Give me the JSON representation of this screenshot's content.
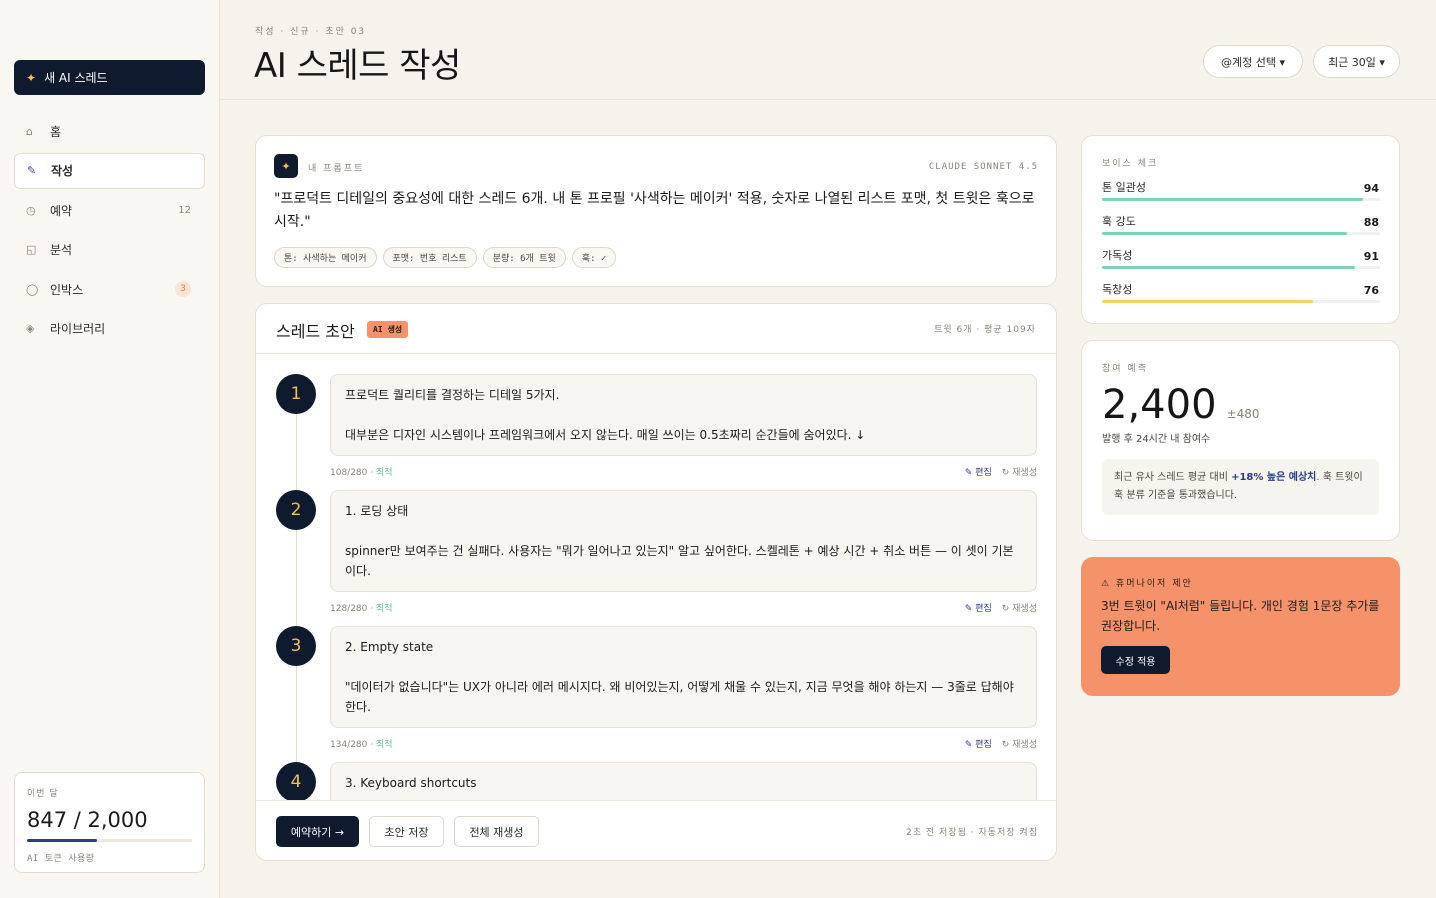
{
  "sidebar": {
    "new_button": "새 AI 스레드",
    "items": [
      {
        "icon": "home-icon",
        "glyph": "⌂",
        "label": "홈"
      },
      {
        "icon": "pencil-icon",
        "glyph": "✎",
        "label": "작성"
      },
      {
        "icon": "clock-icon",
        "glyph": "◷",
        "label": "예약",
        "count": "12"
      },
      {
        "icon": "chart-icon",
        "glyph": "◱",
        "label": "분석"
      },
      {
        "icon": "inbox-icon",
        "glyph": "◯",
        "label": "인박스",
        "badge": "3"
      },
      {
        "icon": "library-icon",
        "glyph": "◈",
        "label": "라이브러리"
      }
    ],
    "usage": {
      "label": "이번 달",
      "value": "847 / 2,000",
      "fraction": 0.4235,
      "sub": "AI 토큰 사용량"
    }
  },
  "header": {
    "breadcrumb": "작성 · 신규 · 초안 03",
    "title": "AI 스레드 작성",
    "account_button": "@계정 선택 ▾",
    "range_button": "최근 30일 ▾"
  },
  "prompt": {
    "label": "내 프롬프트",
    "model": "CLAUDE SONNET 4.5",
    "text": "\"프로덕트 디테일의 중요성에 대한 스레드 6개. 내 톤 프로필 '사색하는 메이커' 적용, 숫자로 나열된 리스트 포맷, 첫 트윗은 훅으로 시작.\"",
    "tags": [
      "톤: 사색하는 메이커",
      "포맷: 번호 리스트",
      "분량: 6개 트윗",
      "훅: ✓"
    ]
  },
  "thread": {
    "title": "스레드 초안",
    "badge": "AI 생성",
    "meta": "트윗 6개 · 평균 109자",
    "tweets": [
      {
        "num": "1",
        "paras": [
          "프로덕트 퀄리티를 결정하는 디테일 5가지.",
          "대부분은 디자인 시스템이나 프레임워크에서 오지 않는다. 매일 쓰이는 0.5초짜리 순간들에 숨어있다. ↓"
        ],
        "count": "108/280",
        "status": "최적"
      },
      {
        "num": "2",
        "paras": [
          "1. 로딩 상태",
          "spinner만 보여주는 건 실패다. 사용자는 \"뭐가 일어나고 있는지\" 알고 싶어한다. 스켈레톤 + 예상 시간 + 취소 버튼 — 이 셋이 기본이다."
        ],
        "count": "128/280",
        "status": "최적"
      },
      {
        "num": "3",
        "paras": [
          "2. Empty state",
          "\"데이터가 없습니다\"는 UX가 아니라 에러 메시지다. 왜 비어있는지, 어떻게 채울 수 있는지, 지금 무엇을 해야 하는지 — 3줄로 답해야 한다."
        ],
        "count": "134/280",
        "status": "최적"
      },
      {
        "num": "4",
        "paras": [
          "3. Keyboard shortcuts"
        ],
        "count": "",
        "status": ""
      }
    ],
    "edit_label": "✎ 편집",
    "regen_label": "↻ 재생성",
    "footer": {
      "schedule": "예약하기 →",
      "save_draft": "초안 저장",
      "regen_all": "전체 재생성",
      "status": "2초 전 저장됨 · 자동저장 켜짐"
    }
  },
  "voice": {
    "label": "보이스 체크",
    "metrics": [
      {
        "name": "톤 일관성",
        "score": 94,
        "color": "#7fd1b9"
      },
      {
        "name": "훅 강도",
        "score": 88,
        "color": "#7fd1b9"
      },
      {
        "name": "가독성",
        "score": 91,
        "color": "#7fd1b9"
      },
      {
        "name": "독창성",
        "score": 76,
        "color": "#f2d36b"
      }
    ]
  },
  "prediction": {
    "label": "참여 예측",
    "value": "2,400",
    "range": "±480",
    "sub": "발행 후 24시간 내 참여수",
    "note_pre": "최근 유사 스레드 평균 대비 ",
    "note_hl": "+18% 높은 예상치",
    "note_post": ". 훅 트윗이 훅 분류 기준을 통과했습니다."
  },
  "humanizer": {
    "label": "⚠ 휴머나이저 제안",
    "text": "3번 트윗이 \"AI처럼\" 들립니다. 개인 경험 1문장 추가를 권장합니다.",
    "button": "수정 적용"
  }
}
